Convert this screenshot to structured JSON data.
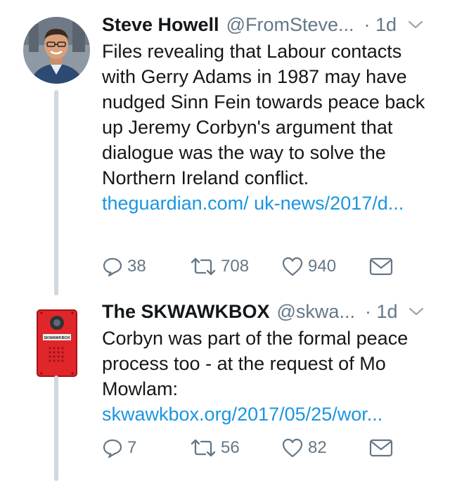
{
  "tweets": [
    {
      "author": {
        "display_name": "Steve Howell",
        "handle": "@FromSteve...",
        "avatar": "profile-photo-man-glasses"
      },
      "time": "· 1d",
      "text": "Files revealing that Labour contacts with Gerry Adams in 1987 may have nudged Sinn Fein towards peace back up Jeremy Corbyn's argument that dialogue was the way to solve the Northern Ireland conflict.",
      "link": "theguardian.com/ uk-news/2017/d...",
      "actions": {
        "replies": "38",
        "retweets": "708",
        "likes": "940"
      }
    },
    {
      "author": {
        "display_name": "The SKWAWKBOX",
        "handle": "@skwa...",
        "avatar": "red-intercom-logo",
        "avatar_text": "THE SKWAWKBOX"
      },
      "time": "· 1d",
      "text": "Corbyn was part of the formal peace process too - at the request of Mo Mowlam:",
      "link": "skwawkbox.org/2017/05/25/wor...",
      "actions": {
        "replies": "7",
        "retweets": "56",
        "likes": "82"
      }
    }
  ],
  "colors": {
    "link": "#1b95e0",
    "secondary": "#657786",
    "thread_line": "#cfd9de",
    "skwawkbox_red": "#e0262b"
  },
  "icons": [
    "reply-icon",
    "retweet-icon",
    "like-icon",
    "direct-message-icon",
    "chevron-down-icon"
  ]
}
